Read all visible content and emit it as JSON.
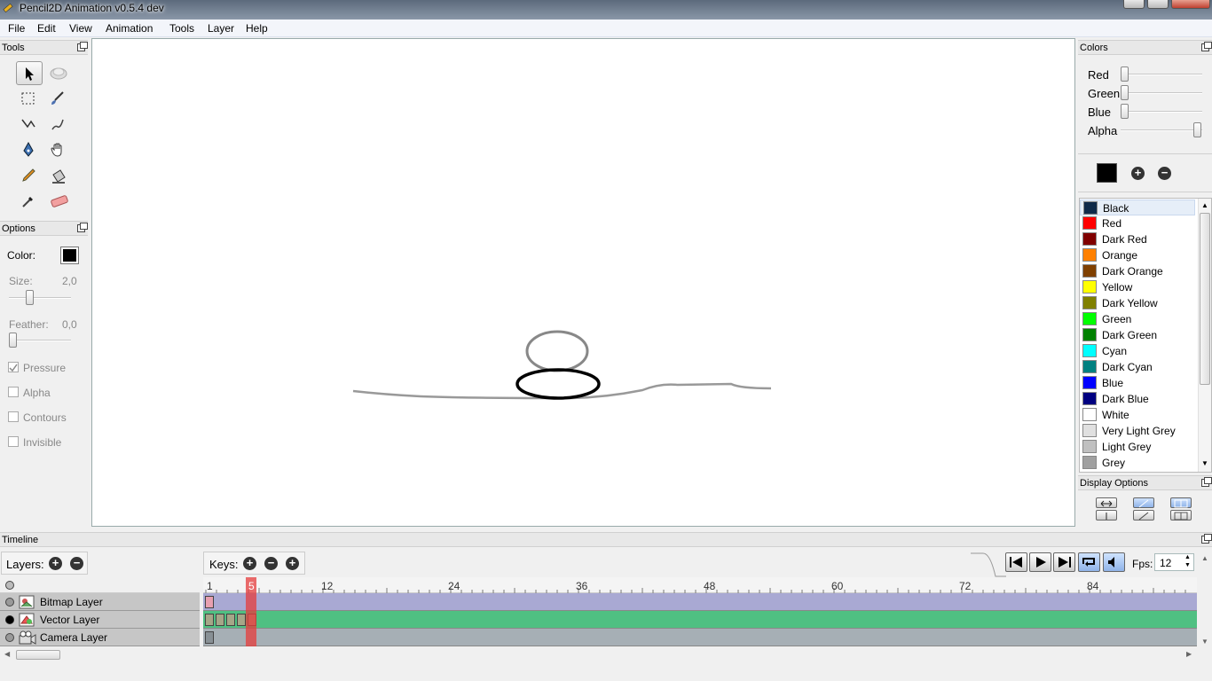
{
  "window": {
    "title": "Pencil2D Animation v0.5.4 dev"
  },
  "menu": [
    "File",
    "Edit",
    "View",
    "Animation",
    "Tools",
    "Layer",
    "Help"
  ],
  "tools_panel": {
    "title": "Tools",
    "tools": [
      "select-tool",
      "smudge-tool",
      "marquee-tool",
      "brush-tool",
      "polyline-tool",
      "eraser-line-tool",
      "pen-tool",
      "hand-tool",
      "pencil-tool",
      "bucket-tool",
      "eyedropper-tool",
      "eraser-tool"
    ],
    "active": "select-tool"
  },
  "options_panel": {
    "title": "Options",
    "color_label": "Color:",
    "color_value": "#000000",
    "size_label": "Size:",
    "size_value": "2,0",
    "feather_label": "Feather:",
    "feather_value": "0,0",
    "checks": [
      {
        "label": "Pressure",
        "checked": true
      },
      {
        "label": "Alpha",
        "checked": false
      },
      {
        "label": "Contours",
        "checked": false
      },
      {
        "label": "Invisible",
        "checked": false
      }
    ]
  },
  "colors_panel": {
    "title": "Colors",
    "sliders": [
      {
        "label": "Red",
        "value": 0
      },
      {
        "label": "Green",
        "value": 0
      },
      {
        "label": "Blue",
        "value": 0
      },
      {
        "label": "Alpha",
        "value": 1
      }
    ],
    "current_color": "#000000",
    "palette": [
      {
        "name": "Black",
        "color": "#0f2a4a"
      },
      {
        "name": "Red",
        "color": "#ff0000"
      },
      {
        "name": "Dark Red",
        "color": "#800000"
      },
      {
        "name": "Orange",
        "color": "#ff8000"
      },
      {
        "name": "Dark Orange",
        "color": "#804000"
      },
      {
        "name": "Yellow",
        "color": "#ffff00"
      },
      {
        "name": "Dark Yellow",
        "color": "#808000"
      },
      {
        "name": "Green",
        "color": "#00ff00"
      },
      {
        "name": "Dark Green",
        "color": "#008000"
      },
      {
        "name": "Cyan",
        "color": "#00ffff"
      },
      {
        "name": "Dark Cyan",
        "color": "#008080"
      },
      {
        "name": "Blue",
        "color": "#0000ff"
      },
      {
        "name": "Dark Blue",
        "color": "#000080"
      },
      {
        "name": "White",
        "color": "#ffffff"
      },
      {
        "name": "Very Light Grey",
        "color": "#e0e0e0"
      },
      {
        "name": "Light Grey",
        "color": "#c0c0c0"
      },
      {
        "name": "Grey",
        "color": "#a0a0a0"
      }
    ]
  },
  "display_options": {
    "title": "Display Options"
  },
  "timeline": {
    "title": "Timeline",
    "layers_label": "Layers:",
    "keys_label": "Keys:",
    "fps_label": "Fps:",
    "fps_value": "12",
    "current_frame": 5,
    "ticks": [
      "1",
      "5",
      "12",
      "24",
      "36",
      "48",
      "60",
      "72",
      "84"
    ],
    "layers": [
      {
        "name": "Bitmap Layer",
        "visible": false,
        "color": "#a9a9d3"
      },
      {
        "name": "Vector Layer",
        "visible": true,
        "color": "#4fc082"
      },
      {
        "name": "Camera Layer",
        "visible": false,
        "color": "#a6afb5"
      }
    ]
  }
}
